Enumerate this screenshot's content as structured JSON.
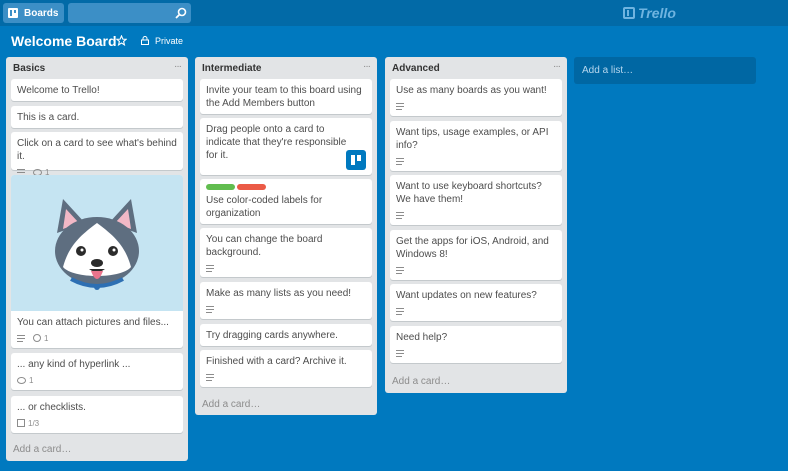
{
  "header": {
    "boards_label": "Boards",
    "search_placeholder": "",
    "logo_text": "Trello"
  },
  "board": {
    "title": "Welcome Board",
    "privacy": "Private"
  },
  "colors": {
    "background": "#0079bf",
    "header": "#026aa7",
    "label_green": "#61bd4f",
    "label_red": "#eb5a46"
  },
  "lists": [
    {
      "title": "Basics",
      "add_card": "Add a card…",
      "cards": [
        {
          "text": "Welcome to Trello!"
        },
        {
          "text": "This is a card."
        },
        {
          "text": "Click on a card to see what's behind it.",
          "comments": "1"
        },
        {
          "text": "You can attach pictures and files...",
          "attachments": "1"
        },
        {
          "text": "... any kind of hyperlink ...",
          "comments": "1"
        },
        {
          "text": "... or checklists.",
          "checklist": "1/3"
        }
      ]
    },
    {
      "title": "Intermediate",
      "add_card": "Add a card…",
      "cards": [
        {
          "text": "Invite your team to this board using the Add Members button"
        },
        {
          "text": "Drag people onto a card to indicate that they're responsible for it."
        },
        {
          "text": "Use color-coded labels for organization"
        },
        {
          "text": "You can change the board background."
        },
        {
          "text": "Make as many lists as you need!"
        },
        {
          "text": "Try dragging cards anywhere."
        },
        {
          "text": "Finished with a card? Archive it."
        }
      ]
    },
    {
      "title": "Advanced",
      "add_card": "Add a card…",
      "cards": [
        {
          "text": "Use as many boards as you want!"
        },
        {
          "text": "Want tips, usage examples, or API info?"
        },
        {
          "text": "Want to use keyboard shortcuts? We have them!"
        },
        {
          "text": "Get the apps for iOS, Android, and Windows 8!"
        },
        {
          "text": "Want updates on new features?"
        },
        {
          "text": "Need help?"
        }
      ]
    }
  ],
  "add_list": "Add a list…"
}
